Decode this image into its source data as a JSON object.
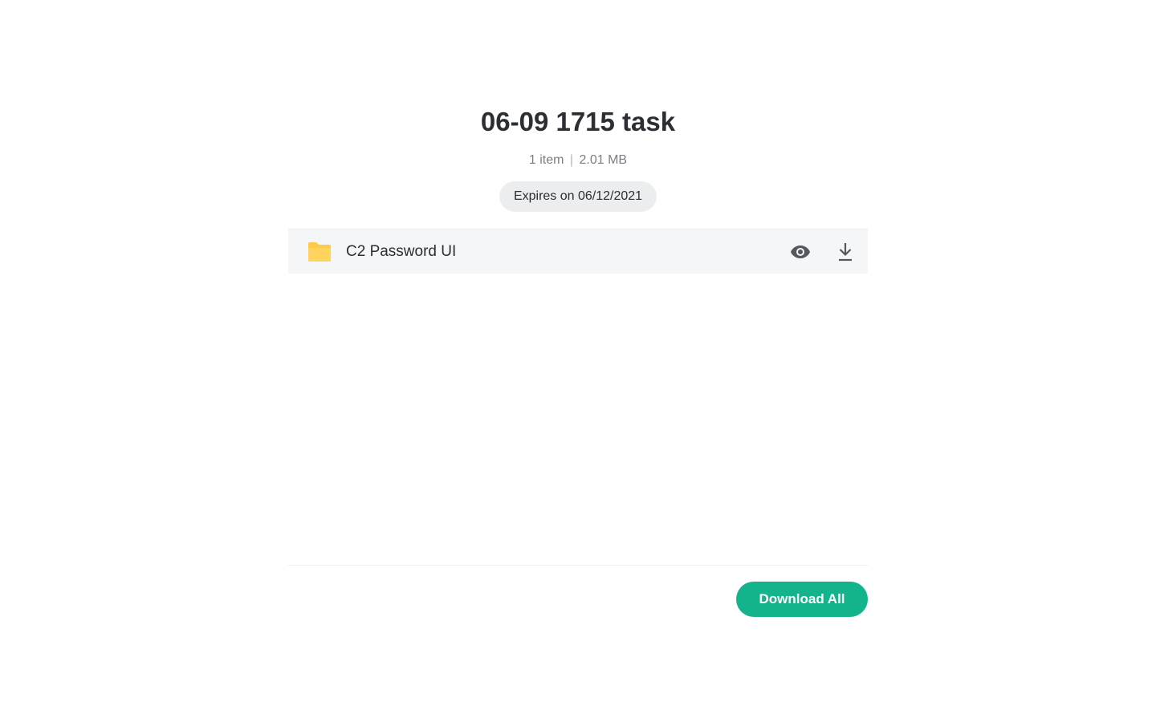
{
  "share": {
    "title": "06-09 1715 task",
    "item_count": "1 item",
    "separator": "|",
    "total_size": "2.01 MB",
    "expiry_label": "Expires on 06/12/2021"
  },
  "files": [
    {
      "name": "C2 Password UI",
      "icon": "folder-icon",
      "icon_color": "#FFC94A",
      "actions": [
        "eye-icon",
        "download-icon"
      ]
    }
  ],
  "footer": {
    "download_all_label": "Download All"
  },
  "colors": {
    "accent": "#13B38C",
    "badge_bg": "#EBEDEF",
    "row_bg": "#F5F6F8"
  }
}
